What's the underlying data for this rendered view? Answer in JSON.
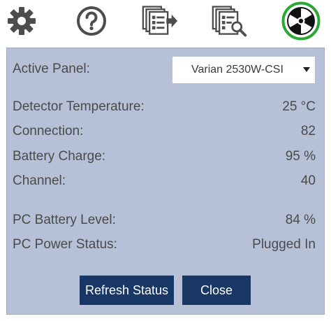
{
  "toolbar": {
    "icons": [
      "gear-icon",
      "help-icon",
      "export-list-icon",
      "preview-search-icon",
      "radiation-icon"
    ],
    "active_icon_color": "#2aa834"
  },
  "panel": {
    "active_panel_label": "Active Panel:",
    "active_panel_value": "Varian 2530W-CSI",
    "rows": [
      {
        "label": "Detector Temperature:",
        "value": "25 °C"
      },
      {
        "label": "Connection:",
        "value": "82"
      },
      {
        "label": "Battery Charge:",
        "value": "95 %"
      },
      {
        "label": "Channel:",
        "value": "40"
      },
      {
        "label": "PC Battery Level:",
        "value": "84 %"
      },
      {
        "label": "PC Power Status:",
        "value": "Plugged In"
      }
    ],
    "refresh_label": "Refresh Status",
    "close_label": "Close"
  },
  "colors": {
    "panel_bg": "#b6c1d7",
    "button_bg": "#183765"
  }
}
